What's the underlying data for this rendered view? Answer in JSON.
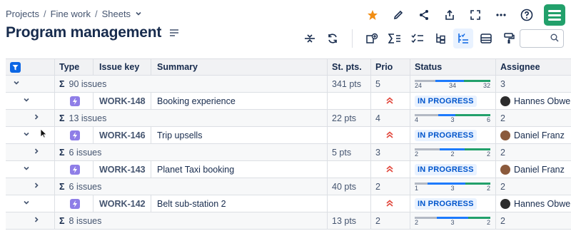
{
  "breadcrumb": {
    "items": [
      "Projects",
      "Fine work",
      "Sheets"
    ]
  },
  "page": {
    "title": "Program management"
  },
  "toolbar": {
    "icons": [
      "collapse-icon",
      "refresh-icon",
      "add-column-icon",
      "sum-icon",
      "checklist-icon",
      "hierarchy-icon",
      "indent-list-icon",
      "fields-icon",
      "paint-format-icon"
    ]
  },
  "colors": {
    "accent": "#0c66e4",
    "logo": "#22a06b",
    "star": "#f18d13",
    "epic": "#8f7ee7",
    "todo": "#b3b9c4",
    "inprogress": "#1d7afc",
    "done": "#22a06b"
  },
  "table": {
    "columns": [
      "Type",
      "Issue key",
      "Summary",
      "St. pts.",
      "Prio",
      "Status",
      "Assignee"
    ],
    "rows": [
      {
        "kind": "sum",
        "expand": "collapse",
        "sigma": "Σ",
        "label": "90 issues",
        "pts": "341 pts",
        "prio": "5",
        "progress": [
          24,
          34,
          32
        ],
        "fractions": [
          0.27,
          0.38,
          0.35
        ],
        "assignee": "3"
      },
      {
        "kind": "issue",
        "expand": "collapse",
        "key": "WORK-148",
        "summary": "Booking experience",
        "status": "IN PROGRESS",
        "assignee": "Hannes Obwe"
      },
      {
        "kind": "sum",
        "expand": "expand",
        "sigma": "Σ",
        "label": "13 issues",
        "pts": "22 pts",
        "prio": "4",
        "progress": [
          4,
          3,
          6
        ],
        "fractions": [
          0.31,
          0.23,
          0.46
        ],
        "assignee": "2"
      },
      {
        "kind": "issue",
        "expand": "collapse",
        "key": "WORK-146",
        "summary": "Trip upsells",
        "status": "IN PROGRESS",
        "assignee": "Daniel Franz"
      },
      {
        "kind": "sum",
        "expand": "expand",
        "sigma": "Σ",
        "label": "6 issues",
        "pts": "5 pts",
        "prio": "3",
        "progress": [
          2,
          2,
          2
        ],
        "fractions": [
          0.33,
          0.33,
          0.34
        ],
        "assignee": "2"
      },
      {
        "kind": "issue",
        "expand": "collapse",
        "key": "WORK-143",
        "summary": "Planet Taxi booking",
        "status": "IN PROGRESS",
        "assignee": "Daniel Franz"
      },
      {
        "kind": "sum",
        "expand": "expand",
        "sigma": "Σ",
        "label": "6 issues",
        "pts": "40 pts",
        "prio": "2",
        "progress": [
          1,
          3,
          2
        ],
        "fractions": [
          0.17,
          0.5,
          0.33
        ],
        "assignee": "2"
      },
      {
        "kind": "issue",
        "expand": "collapse",
        "key": "WORK-142",
        "summary": "Belt sub-station 2",
        "status": "IN PROGRESS",
        "assignee": "Hannes Obwe"
      },
      {
        "kind": "sum",
        "expand": "expand",
        "sigma": "Σ",
        "label": "8 issues",
        "pts": "13 pts",
        "prio": "2",
        "progress": [
          2,
          3,
          2
        ],
        "fractions": [
          0.29,
          0.42,
          0.29
        ],
        "assignee": "2"
      }
    ]
  }
}
